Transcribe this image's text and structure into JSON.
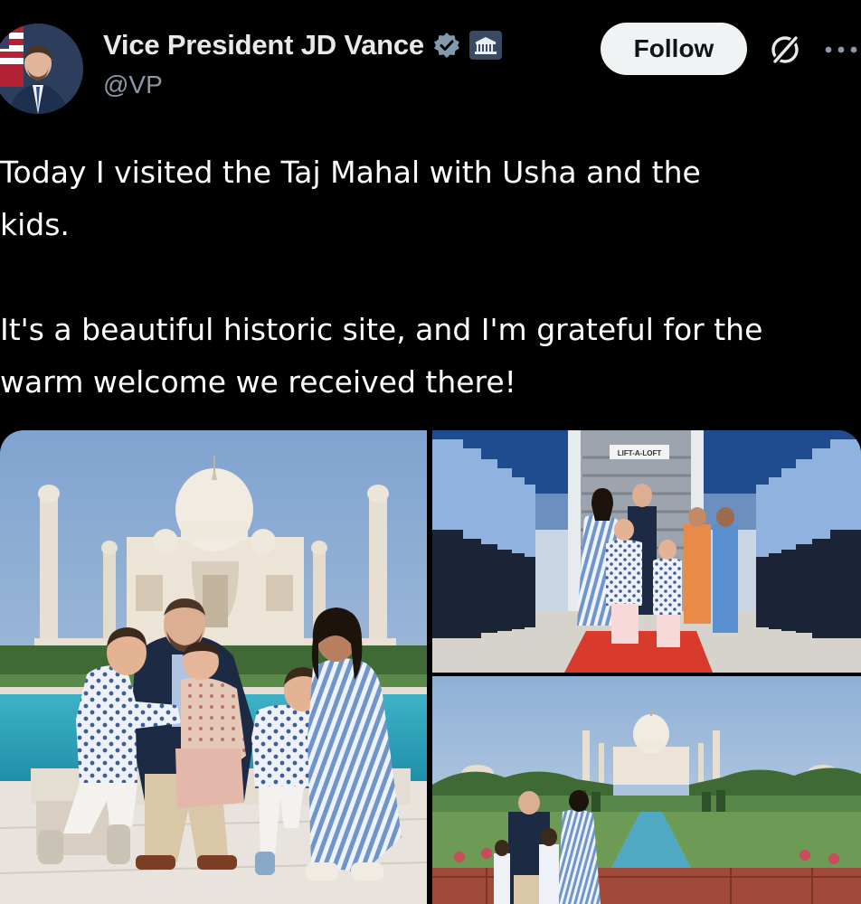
{
  "author": {
    "display_name": "Vice President JD Vance",
    "handle": "@VP",
    "verified_icon": "verified-badge-icon",
    "affiliation_icon": "white-house-icon"
  },
  "actions": {
    "follow_label": "Follow",
    "grok_icon": "grok-icon",
    "more_icon": "more-options-icon"
  },
  "post": {
    "lines": [
      "Today I visited the Taj Mahal with Usha and the",
      "kids.",
      "It's a beautiful historic site, and I'm grateful for the",
      "warm welcome we received there!"
    ]
  },
  "media": {
    "tile_2_sign": "LIFT-A-LOFT"
  },
  "colors": {
    "background": "#000000",
    "text_primary": "#e7e9ea",
    "text_secondary": "#8b98a5",
    "follow_bg": "#eff3f4",
    "verified": "#829aab"
  }
}
